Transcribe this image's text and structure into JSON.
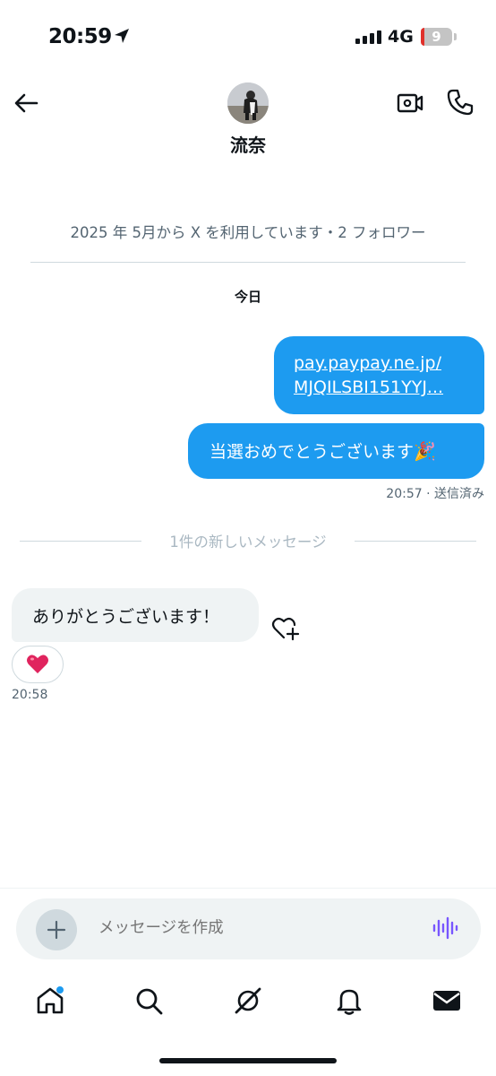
{
  "status_bar": {
    "time": "20:59",
    "network": "4G",
    "battery_percent": "9",
    "battery_level": 0.09,
    "icons": [
      "location-arrow-icon",
      "signal-icon",
      "battery-icon"
    ]
  },
  "header": {
    "contact_name": "流奈",
    "icons": [
      "back-arrow-icon",
      "video-call-icon",
      "phone-call-icon"
    ]
  },
  "profile_info": "2025 年 5月から X を利用しています・2 フォロワー",
  "date_separator": "今日",
  "messages": {
    "outgoing": [
      {
        "lines": [
          "pay.paypay.ne.jp/",
          "MJQILSBI151YYJ..."
        ],
        "type": "link"
      },
      {
        "text": "当選おめでとうございます",
        "emoji": "🎉"
      }
    ],
    "outgoing_meta": "20:57 · 送信済み",
    "new_messages_label": "1件の新しいメッセージ",
    "incoming": {
      "text": "ありがとうございます！",
      "reaction": "❤️",
      "time": "20:58"
    }
  },
  "composer": {
    "placeholder": "メッセージを作成",
    "icons": [
      "plus-icon",
      "voice-wave-icon"
    ]
  },
  "tabbar": {
    "items": [
      "home-icon",
      "search-icon",
      "grok-icon",
      "notifications-icon",
      "messages-icon"
    ],
    "colors": {
      "accent": "#1d9bf0",
      "voice": "#7856ff"
    }
  }
}
